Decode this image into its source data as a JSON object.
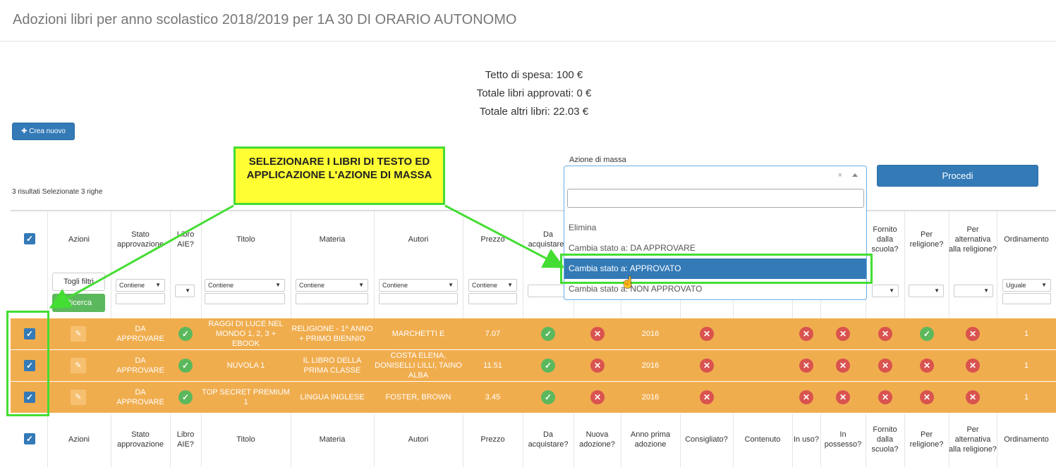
{
  "title": "Adozioni libri per anno scolastico 2018/2019 per 1A 30 DI ORARIO AUTONOMO",
  "totals": {
    "tetto": "Tetto di spesa: 100 €",
    "approvati": "Totale libri approvati: 0 €",
    "altri": "Totale altri libri: 22.03 €"
  },
  "buttons": {
    "new": "✚ Crea nuovo",
    "procedi": "Procedi",
    "togli": "Togli filtri",
    "ricerca": "Ricerca"
  },
  "results": "3 risultati Selezionate 3 righe",
  "mass": {
    "label": "Azione di massa",
    "clear": "×",
    "options": [
      "Elimina",
      "Cambia stato a: DA APPROVARE",
      "Cambia stato a: APPROVATO",
      "Cambia stato a: NON APPROVATO"
    ],
    "highlighted": 2
  },
  "callout": "SELEZIONARE I LIBRI DI TESTO ED APPLICAZIONE L'AZIONE DI MASSA",
  "headers": [
    "Azioni",
    "Stato approvazione",
    "Libro AIE?",
    "Titolo",
    "Materia",
    "Autori",
    "Prezzo",
    "Da acquistare?",
    "Nuova adozione?",
    "Anno prima adozione",
    "Consigliato?",
    "Contenuto",
    "In uso?",
    "In possesso?",
    "Fornito dalla scuola?",
    "Per religione?",
    "Per alternativa alla religione?",
    "Ordinamento"
  ],
  "filters": {
    "contiene": "Contiene",
    "uguale": "Uguale"
  },
  "rows": [
    {
      "stato": "DA APPROVARE",
      "titolo": "RAGGI DI LUCE NEL MONDO 1, 2, 3 + EBOOK",
      "materia": "RELIGIONE - 1^ ANNO + PRIMO BIENNIO",
      "autori": "MARCHETTI E",
      "prezzo": "7.07",
      "anno": "2016",
      "religione": "yes",
      "ord": "1"
    },
    {
      "stato": "DA APPROVARE",
      "titolo": "NUVOLA 1",
      "materia": "IL LIBRO DELLA PRIMA CLASSE",
      "autori": "COSTA ELENA, DONISELLI LILLI, TAINO ALBA",
      "prezzo": "11.51",
      "anno": "2016",
      "religione": "no",
      "ord": "1"
    },
    {
      "stato": "DA APPROVARE",
      "titolo": "TOP SECRET PREMIUM 1",
      "materia": "LINGUA INGLESE",
      "autori": "FOSTER, BROWN",
      "prezzo": "3.45",
      "anno": "2016",
      "religione": "no",
      "ord": "1"
    }
  ],
  "colors": {
    "primary": "#337ab7",
    "row": "#f0ad4e",
    "ok": "#5cb85c",
    "no": "#d9534f",
    "highlight": "#44dd33",
    "callout": "#ffff33"
  }
}
